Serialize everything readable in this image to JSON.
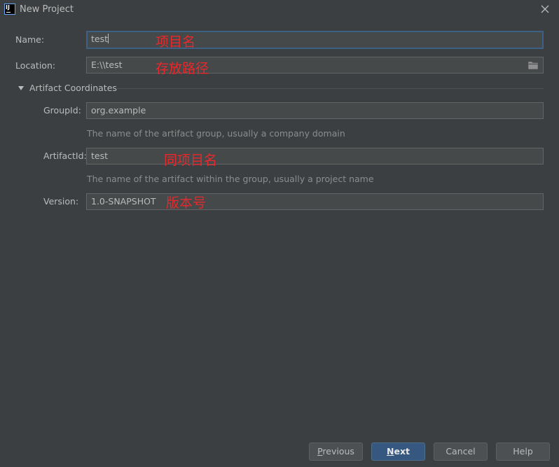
{
  "window": {
    "title": "New Project",
    "app_icon_text": "IJ"
  },
  "form": {
    "name_label": "Name:",
    "name_value": "test",
    "location_label": "Location:",
    "location_value": "E:\\\\test",
    "section_label": "Artifact Coordinates",
    "groupid_label": "GroupId:",
    "groupid_value": "org.example",
    "groupid_hint": "The name of the artifact group, usually a company domain",
    "artifactid_label": "ArtifactId:",
    "artifactid_value": "test",
    "artifactid_hint": "The name of the artifact within the group, usually a project name",
    "version_label": "Version:",
    "version_value": "1.0-SNAPSHOT"
  },
  "annotations": {
    "name": "项目名",
    "location": "存放路径",
    "artifactid": "同项目名",
    "version": "版本号"
  },
  "buttons": {
    "previous_mnemonic": "P",
    "previous_rest": "revious",
    "next_mnemonic": "N",
    "next_rest": "ext",
    "cancel": "Cancel",
    "help": "Help"
  },
  "icons": {
    "app": "intellij-icon",
    "close": "close-icon",
    "folder": "folder-icon",
    "expand": "triangle-down-icon"
  },
  "colors": {
    "background": "#3c3f41",
    "field_bg": "#45494a",
    "focus_border": "#3d6185",
    "primary_button": "#365880",
    "annotation": "#e8282b"
  }
}
